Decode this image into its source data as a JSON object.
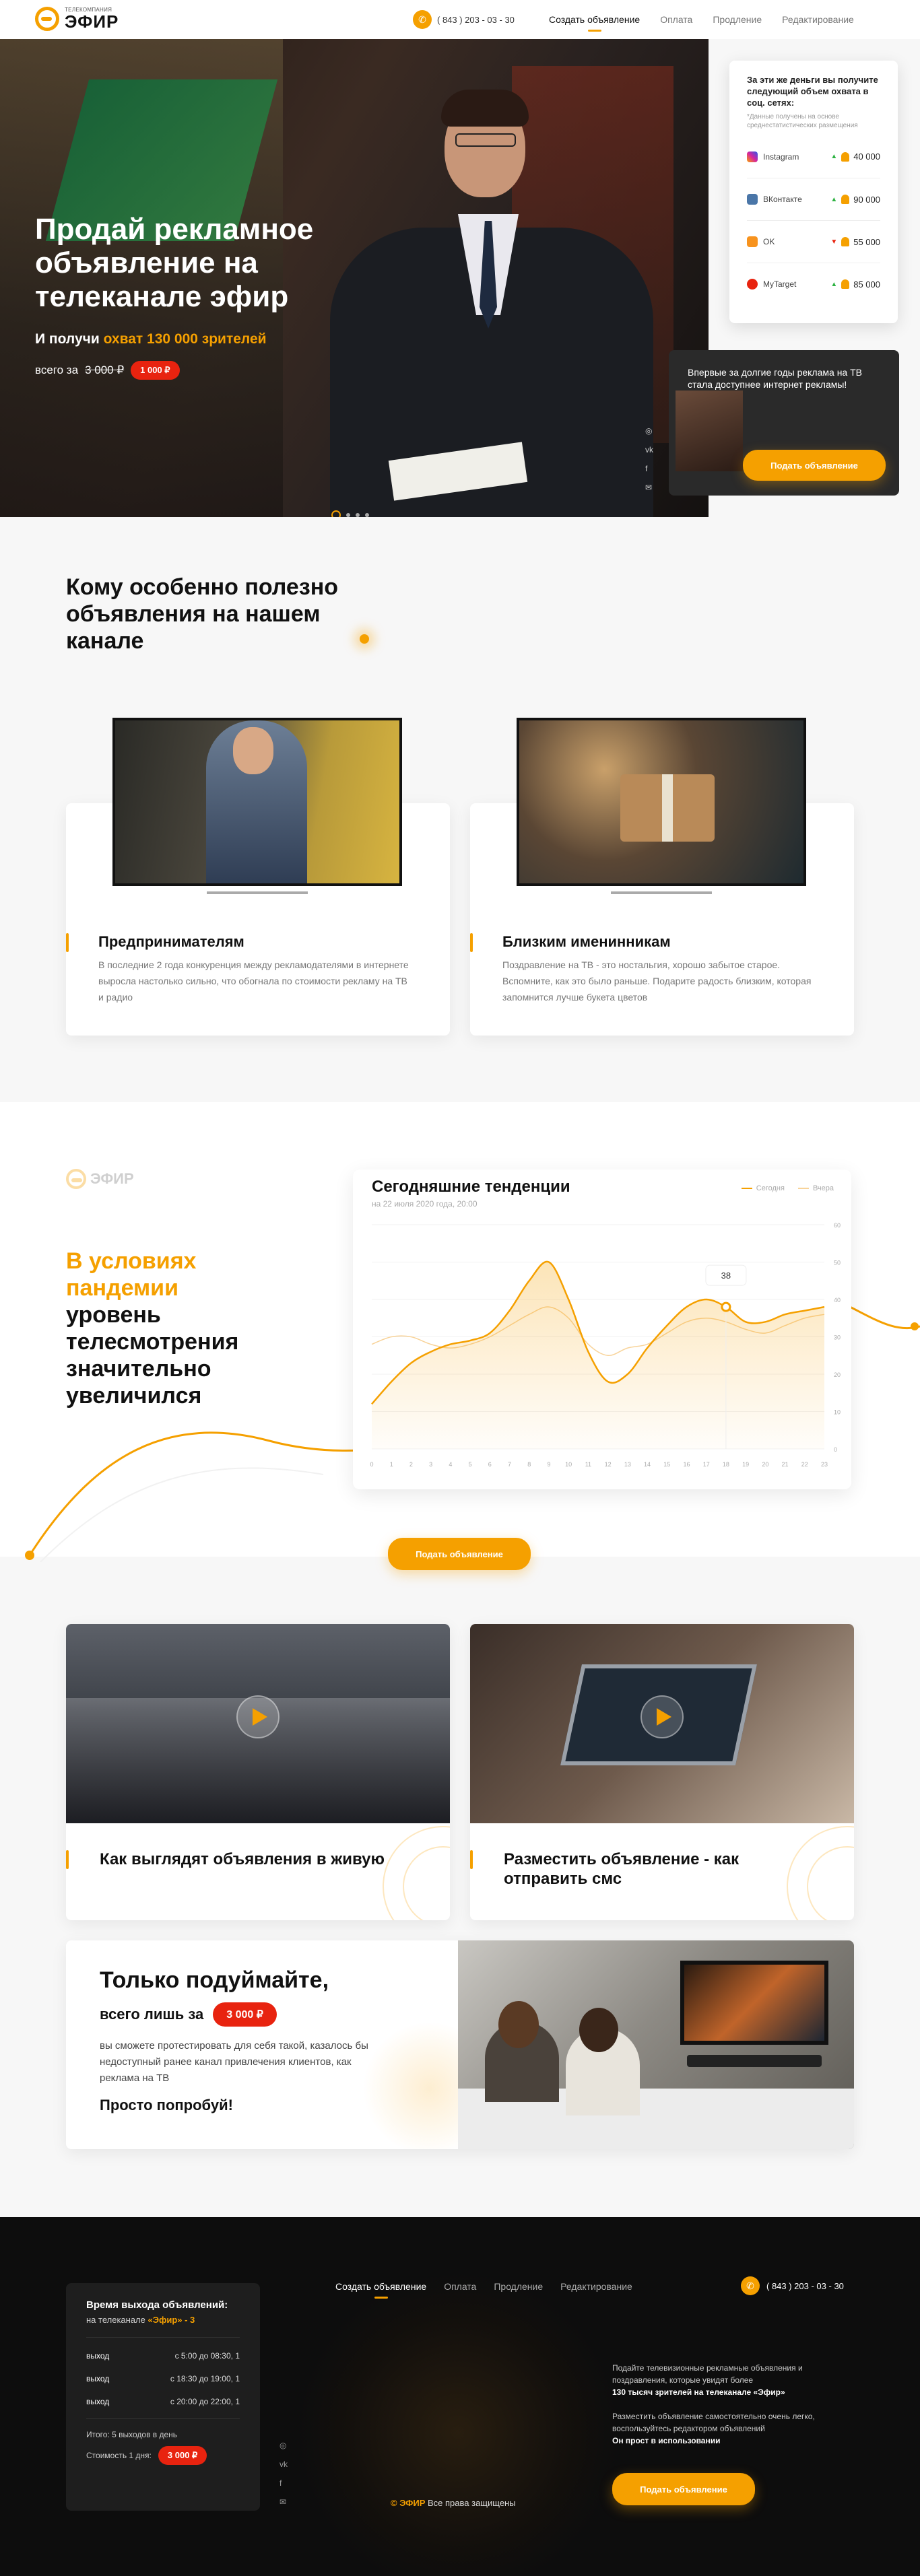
{
  "header": {
    "logo_small": "ТЕЛЕКОМПАНИЯ",
    "logo_big": "ЭФИР",
    "phone": "( 843 ) 203 - 03 - 30",
    "nav": [
      "Создать объявление",
      "Оплата",
      "Продление",
      "Редактирование"
    ]
  },
  "hero": {
    "title": "Продай рекламное объявление на телеканале эфир",
    "sub_prefix": "И получи ",
    "sub_highlight": "охват 130 000 зрителей",
    "price_prefix": "всего за ",
    "old_price": "3 000 ₽",
    "new_price": "1 000 ₽"
  },
  "reach": {
    "title": "За эти же деньги вы получите следующий объем охвата в соц. сетях:",
    "note": "*Данные получены на основе среднестатистических размещения",
    "rows": [
      {
        "name": "Instagram",
        "value": "40 000",
        "icon": "instagram-icon",
        "color": "#d6249f"
      },
      {
        "name": "ВКонтакте",
        "value": "90 000",
        "icon": "vk-icon",
        "color": "#4a76a8"
      },
      {
        "name": "OK",
        "value": "55 000",
        "icon": "ok-icon",
        "color": "#f7931e"
      },
      {
        "name": "MyTarget",
        "value": "85 000",
        "icon": "mytarget-icon",
        "color": "#e8230f"
      }
    ]
  },
  "promo": {
    "text": "Впервые за долгие годы реклама на ТВ стала доступнее интернет рекламы!",
    "button": "Подать объявление"
  },
  "audience": {
    "title": "Кому особенно полезно объявления на нашем канале",
    "cards": [
      {
        "title": "Предпринимателям",
        "desc": "В последние 2 года конкуренция между рекламодателями в интернете выросла настолько сильно, что обогнала по стоимости рекламу на ТВ и радио"
      },
      {
        "title": "Близким именинникам",
        "desc": "Поздравление на ТВ - это ностальгия, хорошо забытое старое. Вспомните, как это было раньше. Подарите радость близким, которая запомнится лучше букета цветов"
      }
    ]
  },
  "trend": {
    "highlight": "В условиях пандемии",
    "rest": "уровень телесмотрения значительно увеличился",
    "chart_title": "Сегодняшние тенденции",
    "chart_date": "на 22 июля 2020 года, 20:00",
    "button": "Подать объявление"
  },
  "chart_data": {
    "type": "area",
    "x": [
      0,
      1,
      2,
      3,
      4,
      5,
      6,
      7,
      8,
      9,
      10,
      11,
      12,
      13,
      14,
      15,
      16,
      17,
      18,
      19,
      20,
      21,
      22,
      23
    ],
    "series": [
      {
        "name": "Сегодня",
        "color": "#f5a000",
        "values": [
          12,
          18,
          23,
          26,
          28,
          29,
          31,
          37,
          45,
          50,
          40,
          26,
          18,
          20,
          27,
          33,
          38,
          40,
          38,
          34,
          34,
          36,
          37,
          38
        ]
      },
      {
        "name": "Вчера",
        "color": "#f8d399",
        "values": [
          28,
          30,
          30,
          28,
          27,
          28,
          30,
          33,
          36,
          38,
          35,
          28,
          25,
          27,
          28,
          31,
          34,
          35,
          34,
          32,
          31,
          33,
          35,
          36
        ]
      }
    ],
    "ylim": [
      0,
      60
    ],
    "yticks": [
      0,
      10,
      20,
      30,
      40,
      50,
      60
    ],
    "tooltip": "38",
    "tooltip_x": 18
  },
  "videos": [
    {
      "title": "Как выглядят объявления в живую"
    },
    {
      "title": "Разместить объявление - как отправить смс"
    }
  ],
  "try": {
    "title": "Только подуймайте,",
    "sub": "всего лишь за",
    "price": "3 000 ₽",
    "desc": "вы сможете протестировать для себя такой, казалось бы недоступный ранее канал привлечения клиентов, как реклама на ТВ",
    "cta": "Просто попробуй!"
  },
  "footer": {
    "sched_title": "Время выхода объявлений:",
    "sched_channel_prefix": "на телеканале ",
    "sched_channel": "«Эфир» - 3",
    "rows": [
      {
        "label": "выход",
        "time": "с 5:00 до 08:30, 1"
      },
      {
        "label": "выход",
        "time": "с 18:30 до 19:00, 1"
      },
      {
        "label": "выход",
        "time": "с 20:00 до 22:00, 1"
      }
    ],
    "total": "Итого: 5 выходов в день",
    "cost_label": "Стоимость 1 дня:",
    "cost": "3 000 ₽",
    "nav": [
      "Создать объявление",
      "Оплата",
      "Продление",
      "Редактирование"
    ],
    "phone": "( 843 ) 203 - 03 - 30",
    "desc1": "Подайте телевизионные рекламные объявления и поздравления, которые увидят более",
    "desc1b": "130 тысяч зрителей на телеканале «Эфир»",
    "desc2": "Разместить объявление самостоятельно очень легко, воспользуйтесь редактором объявлений",
    "desc2b": "Он прост в использовании",
    "button": "Подать объявление",
    "copy_brand": "© ЭФИР",
    "copy_rest": " Все права защищены"
  }
}
